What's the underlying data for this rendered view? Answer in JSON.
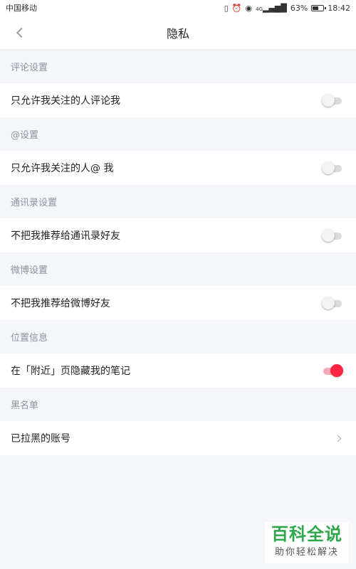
{
  "status_bar": {
    "carrier": "中国移动",
    "icons": [
      "vibrate-icon",
      "alarm-icon",
      "eye-icon",
      "signal-icon"
    ],
    "signal_text": "4G",
    "battery_percent": "63%",
    "battery_level": 0.63,
    "time": "18:42"
  },
  "nav": {
    "back_icon": "chevron-left-icon",
    "title": "隐私"
  },
  "sections": {
    "comment": {
      "header": "评论设置",
      "row_label": "只允许我关注的人评论我",
      "toggle_on": false
    },
    "mention": {
      "header": "@设置",
      "row_label": "只允许我关注的人@ 我",
      "toggle_on": false
    },
    "contacts": {
      "header": "通讯录设置",
      "row_label": "不把我推荐给通讯录好友",
      "toggle_on": false
    },
    "weibo": {
      "header": "微博设置",
      "row_label": "不把我推荐给微博好友",
      "toggle_on": false
    },
    "location": {
      "header": "位置信息",
      "row_label": "在「附近」页隐藏我的笔记",
      "toggle_on": true
    },
    "blacklist": {
      "header": "黑名单",
      "row_label": "已拉黑的账号",
      "chevron_icon": "chevron-right-icon"
    }
  },
  "watermark": {
    "title": "百科全说",
    "subtitle": "助你轻松解决"
  },
  "colors": {
    "accent": "#ff2442",
    "accent_track": "#f7a9b5",
    "background": "#f4f6f9",
    "section_text": "#8d939b",
    "watermark_green": "#2fa64a"
  }
}
